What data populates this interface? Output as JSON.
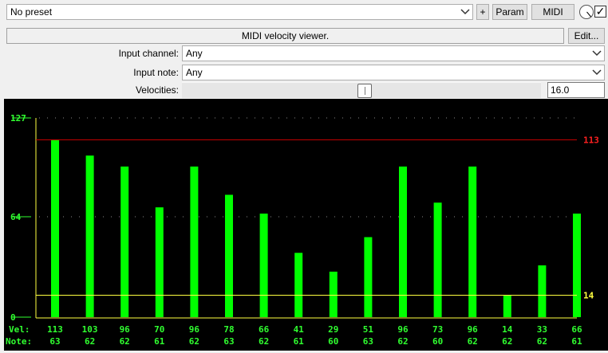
{
  "toolbar": {
    "preset": "No preset",
    "add_label": "+",
    "param_label": "Param",
    "midi_label": "MIDI",
    "enabled": true
  },
  "plugin": {
    "description": "MIDI velocity viewer.",
    "edit_label": "Edit..."
  },
  "params": {
    "input_channel": {
      "label": "Input channel:",
      "value": "Any"
    },
    "input_note": {
      "label": "Input note:",
      "value": "Any"
    },
    "velocities": {
      "label": "Velocities:",
      "value": "16.0",
      "slider_fraction": 0.51
    }
  },
  "chart_data": {
    "type": "bar",
    "ylim": [
      0,
      127
    ],
    "y_ticks": [
      "127",
      "64",
      "0"
    ],
    "max_marker": {
      "value": 113,
      "label": "113",
      "color": "#ff2020"
    },
    "min_marker": {
      "value": 14,
      "label": "14",
      "color": "#ffff40"
    },
    "row_labels": {
      "vel": "Vel:",
      "note": "Note:"
    },
    "velocities": [
      113,
      103,
      96,
      70,
      96,
      78,
      66,
      41,
      29,
      51,
      96,
      73,
      96,
      14,
      33,
      66
    ],
    "vel_labels": [
      "113",
      "103",
      "96",
      "70",
      "96",
      "78",
      "66",
      "41",
      "29",
      "51",
      "96",
      "73",
      "96",
      "14",
      "33",
      "66"
    ],
    "notes": [
      "63",
      "62",
      "62",
      "61",
      "62",
      "63",
      "62",
      "61",
      "60",
      "63",
      "62",
      "60",
      "62",
      "62",
      "62",
      "61"
    ],
    "bar_color": "#00ff00",
    "text_color": "#30ff30",
    "background": "#000000"
  }
}
